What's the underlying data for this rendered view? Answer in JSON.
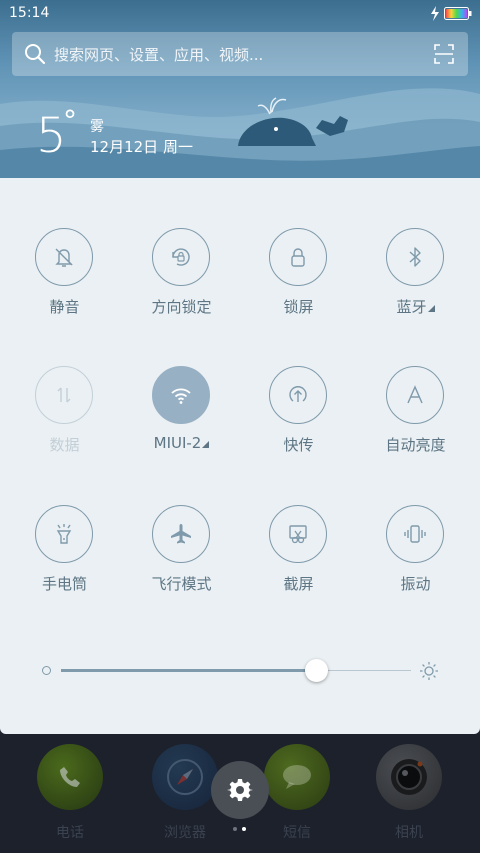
{
  "status_bar": {
    "time": "15:14"
  },
  "search": {
    "placeholder": "搜索网页、设置、应用、视频..."
  },
  "weather": {
    "temperature": "5",
    "degree": "°",
    "condition": "雾",
    "date": "12月12日 周一"
  },
  "toggles": [
    {
      "label": "静音",
      "icon": "mute-bell-icon",
      "state": "off"
    },
    {
      "label": "方向锁定",
      "icon": "rotation-lock-icon",
      "state": "off"
    },
    {
      "label": "锁屏",
      "icon": "lock-icon",
      "state": "off"
    },
    {
      "label": "蓝牙",
      "icon": "bluetooth-icon",
      "state": "off",
      "has_more": true
    },
    {
      "label": "数据",
      "icon": "data-arrows-icon",
      "state": "disabled"
    },
    {
      "label": "MIUI-2",
      "icon": "wifi-icon",
      "state": "on",
      "has_more": true
    },
    {
      "label": "快传",
      "icon": "quick-transfer-icon",
      "state": "off"
    },
    {
      "label": "自动亮度",
      "icon": "auto-brightness-icon",
      "state": "off"
    },
    {
      "label": "手电筒",
      "icon": "flashlight-icon",
      "state": "off"
    },
    {
      "label": "飞行模式",
      "icon": "airplane-icon",
      "state": "off"
    },
    {
      "label": "截屏",
      "icon": "screenshot-icon",
      "state": "off"
    },
    {
      "label": "振动",
      "icon": "vibrate-icon",
      "state": "off"
    }
  ],
  "brightness": {
    "level": 0.73
  },
  "dock": {
    "apps": [
      {
        "label": "电话",
        "icon": "phone-icon"
      },
      {
        "label": "浏览器",
        "icon": "compass-icon"
      },
      {
        "label": "短信",
        "icon": "message-icon"
      },
      {
        "label": "相机",
        "icon": "camera-icon"
      }
    ],
    "settings_icon": "gear-icon",
    "page_count": 2,
    "current_page": 2
  },
  "colors": {
    "accent": "#97b0c3",
    "panel_bg": "#eaf0f3",
    "icon_stroke": "#7f9aab",
    "label": "#5d7584",
    "disabled": "#c3d0d8"
  }
}
